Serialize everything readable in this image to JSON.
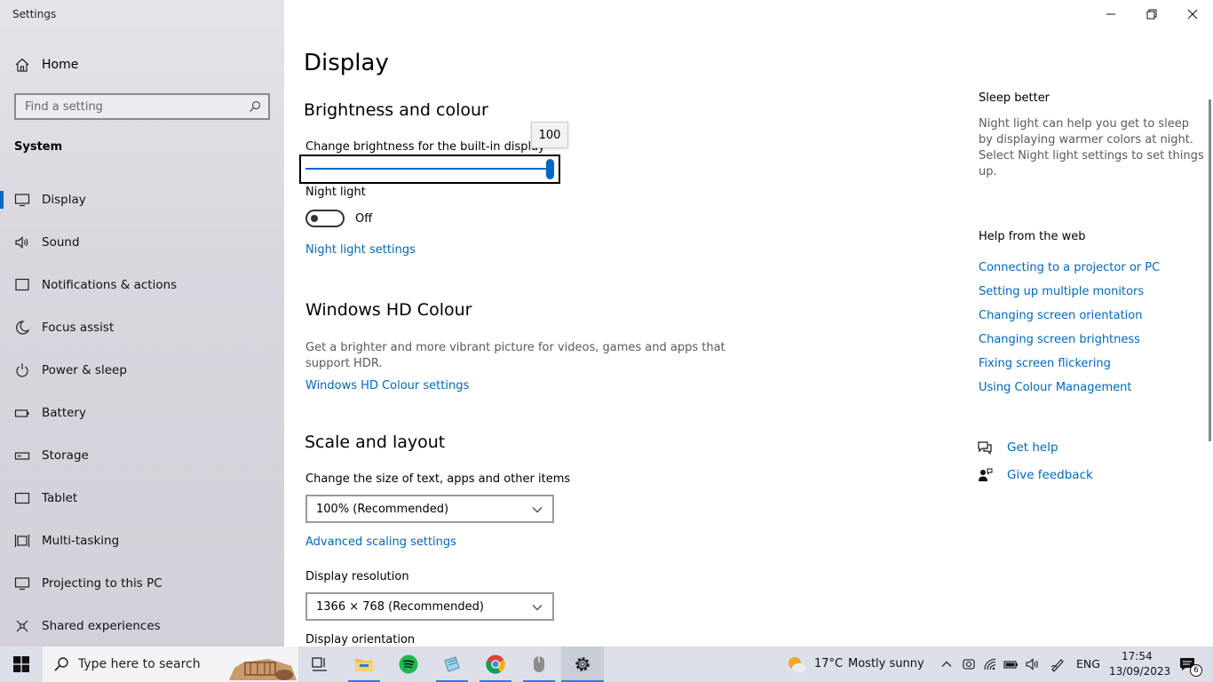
{
  "window": {
    "title": "Settings"
  },
  "sidebar": {
    "home_label": "Home",
    "search_placeholder": "Find a setting",
    "section_title": "System",
    "items": [
      {
        "label": "Display",
        "icon": "monitor-icon",
        "selected": true
      },
      {
        "label": "Sound",
        "icon": "speaker-icon"
      },
      {
        "label": "Notifications & actions",
        "icon": "notification-icon"
      },
      {
        "label": "Focus assist",
        "icon": "moon-icon"
      },
      {
        "label": "Power & sleep",
        "icon": "power-icon"
      },
      {
        "label": "Battery",
        "icon": "battery-icon"
      },
      {
        "label": "Storage",
        "icon": "storage-icon"
      },
      {
        "label": "Tablet",
        "icon": "tablet-icon"
      },
      {
        "label": "Multi-tasking",
        "icon": "multitasking-icon"
      },
      {
        "label": "Projecting to this PC",
        "icon": "projecting-icon"
      },
      {
        "label": "Shared experiences",
        "icon": "shared-icon"
      }
    ]
  },
  "main": {
    "page_title": "Display",
    "brightness": {
      "heading": "Brightness and colour",
      "slider_label": "Change brightness for the built-in display",
      "value": "100",
      "level": 100
    },
    "night_light": {
      "label": "Night light",
      "state": "Off",
      "settings_link": "Night light settings"
    },
    "hdr": {
      "heading": "Windows HD Colour",
      "description_line1": "Get a brighter and more vibrant picture for videos, games and apps that",
      "description_line2": "support HDR.",
      "settings_link": "Windows HD Colour settings"
    },
    "scale": {
      "heading": "Scale and layout",
      "size_label": "Change the size of text, apps and other items",
      "size_value": "100% (Recommended)",
      "advanced_link": "Advanced scaling settings",
      "resolution_label": "Display resolution",
      "resolution_value": "1366 × 768 (Recommended)",
      "orientation_label": "Display orientation"
    }
  },
  "right_panel": {
    "sleep_heading": "Sleep better",
    "sleep_text": [
      "Night light can help you get to sleep",
      "by displaying warmer colors at night.",
      "Select Night light settings to set things",
      "up."
    ],
    "help_heading": "Help from the web",
    "help_links": [
      "Connecting to a projector or PC",
      "Setting up multiple monitors",
      "Changing screen orientation",
      "Changing screen brightness",
      "Fixing screen flickering",
      "Using Colour Management"
    ],
    "get_help": "Get help",
    "give_feedback": "Give feedback"
  },
  "taskbar": {
    "search_placeholder": "Type here to search",
    "weather_temp": "17°C",
    "weather_desc": "Mostly sunny",
    "language": "ENG",
    "time": "17:54",
    "date": "13/09/2023",
    "notification_count": "6"
  },
  "colors": {
    "accent": "#0067c0",
    "sidebar_bg": "#d9d6de",
    "taskbar_bg": "#dcdfe8"
  }
}
